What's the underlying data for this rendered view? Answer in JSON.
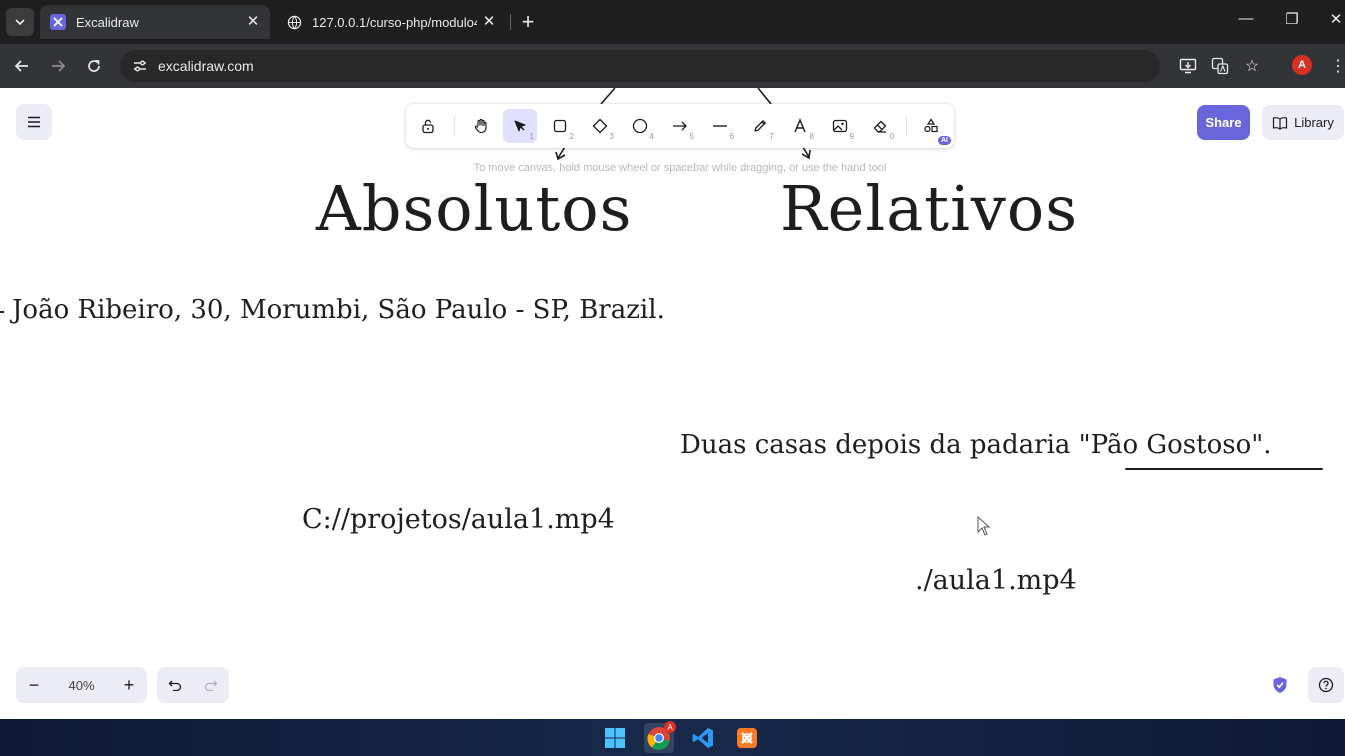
{
  "browser": {
    "tabs": [
      {
        "title": "Excalidraw",
        "active": true,
        "icon": "excalidraw-favicon"
      },
      {
        "title": "127.0.0.1/curso-php/modulo4/",
        "active": false,
        "icon": "globe-icon"
      }
    ],
    "new_tab_label": "+",
    "url": "excalidraw.com",
    "profile_initial": "A"
  },
  "excalidraw": {
    "toolbar": {
      "tools": [
        {
          "name": "lock",
          "key": ""
        },
        {
          "name": "hand",
          "key": ""
        },
        {
          "name": "selection",
          "key": "1"
        },
        {
          "name": "rectangle",
          "key": "2"
        },
        {
          "name": "diamond",
          "key": "3"
        },
        {
          "name": "ellipse",
          "key": "4"
        },
        {
          "name": "arrow",
          "key": "5"
        },
        {
          "name": "line",
          "key": "6"
        },
        {
          "name": "draw",
          "key": "7"
        },
        {
          "name": "text",
          "key": "8"
        },
        {
          "name": "image",
          "key": "9"
        },
        {
          "name": "eraser",
          "key": "0"
        },
        {
          "name": "more-tools",
          "key": "AI"
        }
      ],
      "selected": "selection"
    },
    "hint": "To move canvas, hold mouse wheel or spacebar while dragging, or use the hand tool",
    "share_label": "Share",
    "library_label": "Library",
    "zoom": "40%",
    "zoom_out_label": "−",
    "zoom_in_label": "+",
    "accent": "#6965db"
  },
  "canvas": {
    "heading_absolutos": "Absolutos",
    "heading_relativos": "Relativos",
    "address_text": "João Ribeiro, 30, Morumbi, São Paulo - SP, Brazil.",
    "relative_address_prefix": "Duas casas depois da padaria \"",
    "relative_address_underlined": "Pão Gostoso",
    "relative_address_suffix": "\".",
    "absolute_path": "C://projetos/aula1.mp4",
    "relative_path": "./aula1.mp4"
  },
  "taskbar": {
    "apps": [
      "windows-start",
      "chrome",
      "vscode",
      "xampp"
    ],
    "chrome_badge": "A"
  }
}
